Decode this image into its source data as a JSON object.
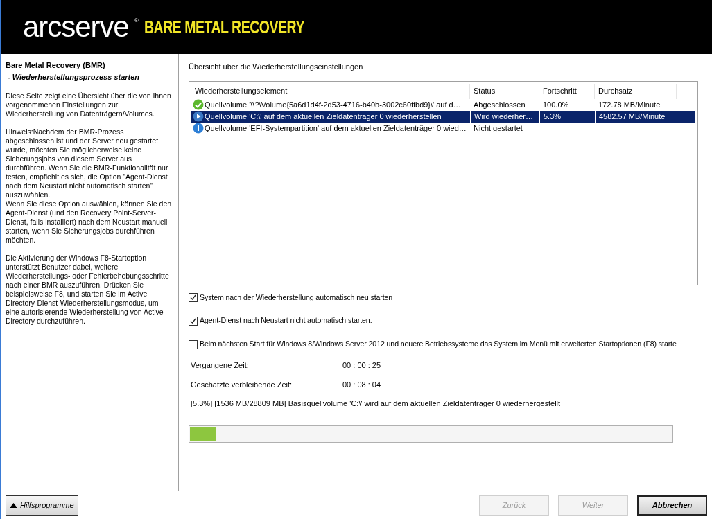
{
  "header": {
    "logo": "arcserve",
    "logo_mark": "®",
    "product": "BARE METAL RECOVERY"
  },
  "sidebar": {
    "title": "Bare Metal Recovery (BMR)",
    "subtitle": " - Wiederherstellungsprozess starten",
    "paragraphs": [
      "Diese Seite zeigt eine Übersicht über die von Ihnen vorgenommenen Einstellungen zur Wiederherstellung von Datenträgern/Volumes.",
      "Hinweis:Nachdem der BMR-Prozess abgeschlossen ist und der Server neu gestartet wurde, möchten Sie möglicherweise keine Sicherungsjobs von diesem Server aus durchführen. Wenn Sie die BMR-Funktionalität nur testen, empfiehlt es sich, die Option \"Agent-Dienst nach dem Neustart nicht automatisch starten\" auszuwählen.\nWenn Sie diese Option auswählen, können Sie den Agent-Dienst (und den Recovery Point-Server-Dienst, falls installiert) nach dem Neustart manuell starten, wenn Sie Sicherungsjobs durchführen möchten.",
      "Die Aktivierung der Windows F8-Startoption unterstützt Benutzer dabei, weitere Wiederherstellungs- oder Fehlerbehebungsschritte nach einer BMR auszuführen. Drücken Sie beispielsweise F8, und starten Sie im Active Directory-Dienst-Wiederherstellungsmodus, um eine autorisierende Wiederherstellung von Active Directory durchzuführen."
    ]
  },
  "section_title": "Übersicht über die Wiederherstellungseinstellungen",
  "table": {
    "columns": [
      "Wiederherstellungselement",
      "Status",
      "Fortschritt",
      "Durchsatz"
    ],
    "rows": [
      {
        "kind": "done",
        "selected": false,
        "cells": [
          "Quellvolume '\\\\?\\Volume{5a6d1d4f-2d53-4716-b40b-3002c60ffbd9}\\' auf d…",
          "Abgeschlossen",
          "100.0%",
          "172.78 MB/Minute"
        ]
      },
      {
        "kind": "running",
        "selected": true,
        "cells": [
          "Quellvolume 'C:\\' auf dem aktuellen Zieldatenträger 0 wiederherstellen",
          "Wird wiederher…",
          "5.3%",
          "4582.57 MB/Minute"
        ]
      },
      {
        "kind": "pending",
        "selected": false,
        "cells": [
          "Quellvolume 'EFI-Systempartition' auf dem aktuellen Zieldatenträger 0 wied…",
          "Nicht gestartet"
        ]
      }
    ]
  },
  "options": [
    {
      "label": "System nach der Wiederherstellung automatisch neu starten",
      "checked": true
    },
    {
      "label": "Agent-Dienst nach Neustart nicht automatisch starten.",
      "checked": true
    },
    {
      "label": "Beim nächsten Start für Windows 8/Windows Server 2012 und neuere Betriebssysteme das System im Menü mit erweiterten Startoptionen (F8) starte",
      "checked": false
    }
  ],
  "times": [
    {
      "label": "Vergangene Zeit:",
      "value": "00 : 00 : 25"
    },
    {
      "label": "Geschätzte verbleibende Zeit:",
      "value": "00 : 08 : 04"
    }
  ],
  "status_text": "[5.3%] [1536 MB/28809 MB] Basisquellvolume 'C:\\' wird auf dem aktuellen Zieldatenträger 0 wiederhergestellt",
  "progress": {
    "level": 0.053
  },
  "footer": {
    "tools_button": "Hilfsprogramme",
    "buttons": [
      {
        "label": "Zurück",
        "disabled": true,
        "default": false
      },
      {
        "label": "Weiter",
        "disabled": true,
        "default": false
      },
      {
        "label": "Abbrechen",
        "disabled": false,
        "default": true
      }
    ]
  }
}
